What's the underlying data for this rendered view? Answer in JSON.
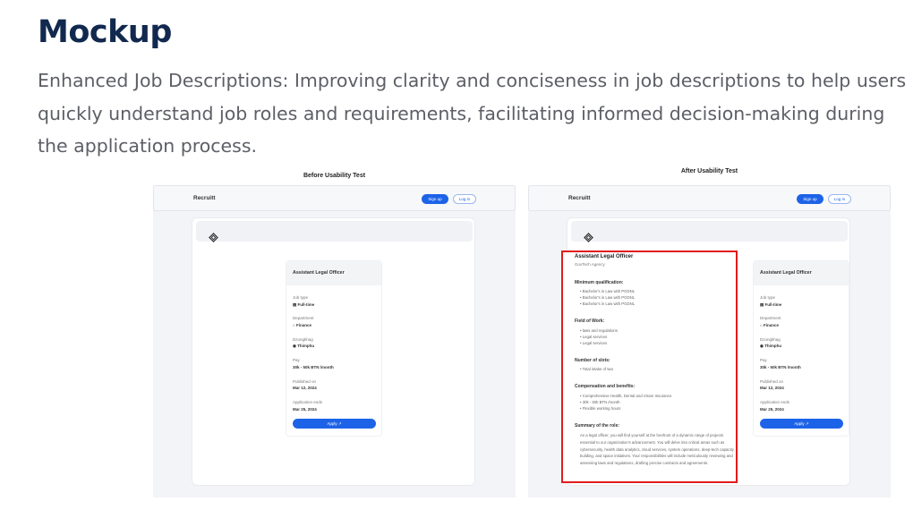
{
  "heading": "Mockup",
  "description": "Enhanced Job Descriptions: Improving clarity and conciseness in job descriptions to help users quickly understand job roles and requirements, facilitating informed decision-making during the application process.",
  "before": {
    "label": "Before Usability Test",
    "brand": "Recruitt",
    "signup": "Sign up",
    "login": "Log in",
    "job_title": "Assistant Legal Officer",
    "fields": [
      {
        "label": "Job type",
        "value": "Full-time",
        "icon": "briefcase-icon"
      },
      {
        "label": "Department",
        "value": "Finance",
        "icon": "building-icon"
      },
      {
        "label": "Dzongkhag",
        "value": "Thimphu",
        "icon": "location-pin-icon"
      },
      {
        "label": "Pay",
        "value": "30k - 50k BTN /month"
      },
      {
        "label": "Published on",
        "value": "Mar 12, 2024"
      },
      {
        "label": "Application ends",
        "value": "Mar 25, 2024"
      }
    ],
    "apply": "Apply"
  },
  "after": {
    "label": "After Usability Test",
    "brand": "Recruitt",
    "signup": "Sign up",
    "login": "Log in",
    "job_title": "Assistant Legal Officer",
    "agency": "GovTech Agency",
    "sections": {
      "min_qual": {
        "heading": "Minimum qualification:",
        "items": [
          "Bachelor's in Law with PGDNL",
          "Bachelor's in Law with PGDNL",
          "Bachelor's in Law with PGDNL"
        ]
      },
      "field": {
        "heading": "Field of Work:",
        "items": [
          "laws and regulations",
          "Legal services",
          "Legal services"
        ]
      },
      "slots": {
        "heading": "Number of slots:",
        "items": [
          "Total intake of two"
        ]
      },
      "comp": {
        "heading": "Compensation and benefits:",
        "items": [
          "Comprehensive Health, Dental and Vision Insurance",
          "30k - 50k BTN /month",
          "Flexible working hours"
        ]
      },
      "summary": {
        "heading": "Summary of the role:",
        "text": "As a legal officer, you will find yourself at the forefront of a dynamic range of projects essential to our organization's advancement. You will delve into critical areas such as cybersecurity, health data analytics, cloud services, system operations, deep-tech capacity building, and space initiatives. Your responsibilities will include meticulously reviewing and assessing laws and regulations, drafting precise contracts and agreements."
      }
    },
    "card_title": "Assistant Legal Officer",
    "fields": [
      {
        "label": "Job type",
        "value": "Full-time",
        "icon": "briefcase-icon"
      },
      {
        "label": "Department",
        "value": "Finance",
        "icon": "building-icon"
      },
      {
        "label": "Dzongkhag",
        "value": "Thimphu",
        "icon": "location-pin-icon"
      },
      {
        "label": "Pay",
        "value": "30k - 50k BTN /month"
      },
      {
        "label": "Published on",
        "value": "Mar 12, 2024"
      },
      {
        "label": "Application ends",
        "value": "Mar 25, 2024"
      }
    ],
    "apply": "Apply"
  },
  "colors": {
    "heading": "#12294f",
    "primary": "#1d63e8",
    "highlight": "#e21c1c"
  }
}
